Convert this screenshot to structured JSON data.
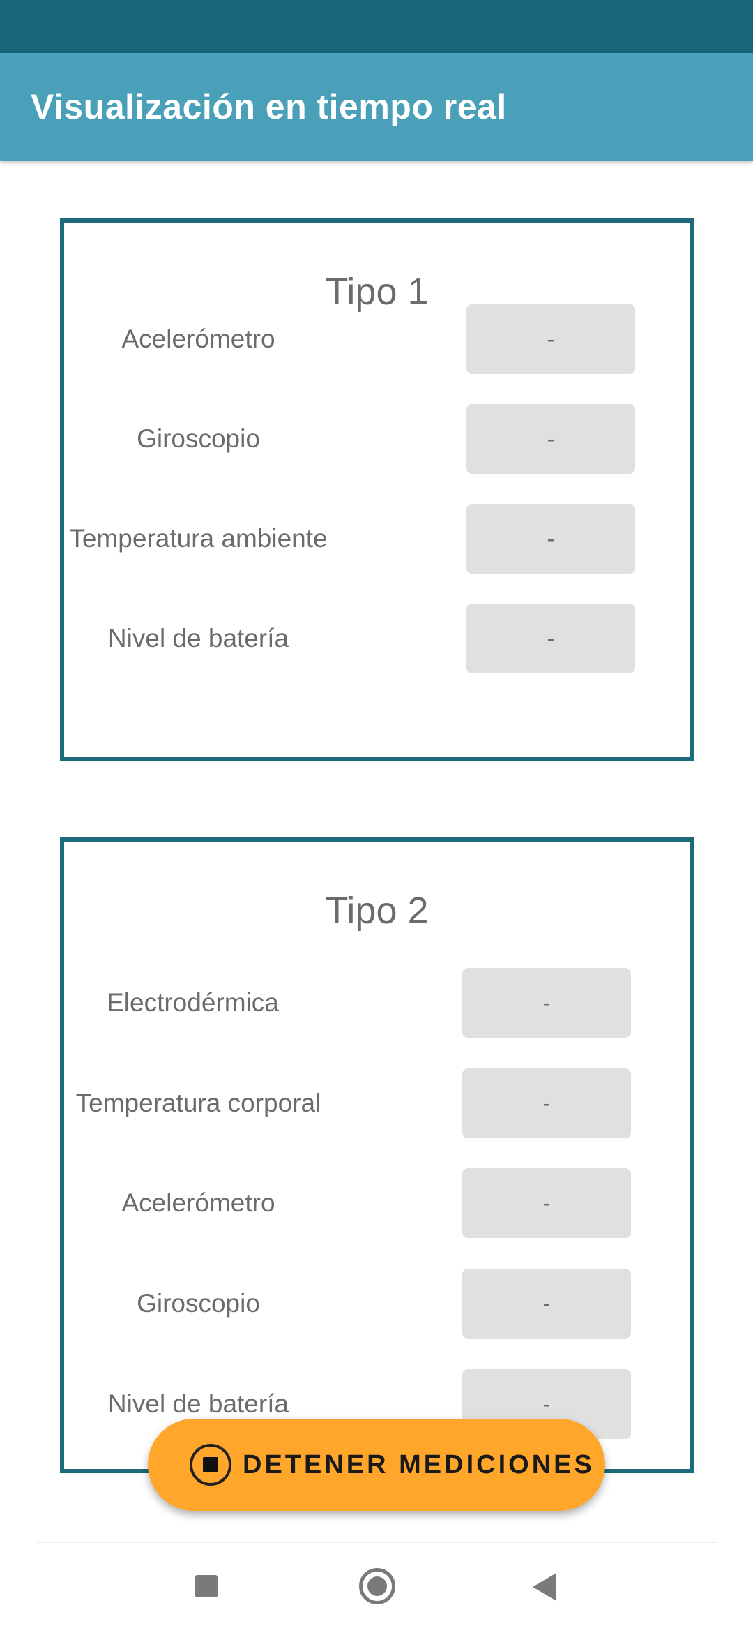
{
  "app_bar": {
    "title": "Visualización en tiempo real"
  },
  "cards": [
    {
      "title": "Tipo 1",
      "rows": [
        {
          "label": "Acelerómetro",
          "value": "-"
        },
        {
          "label": "Giroscopio",
          "value": "-"
        },
        {
          "label": "Temperatura ambiente",
          "value": "-"
        },
        {
          "label": "Nivel de batería",
          "value": "-"
        }
      ]
    },
    {
      "title": "Tipo 2",
      "rows": [
        {
          "label": "Electrodérmica",
          "value": "-"
        },
        {
          "label": "Temperatura corporal",
          "value": "-"
        },
        {
          "label": "Acelerómetro",
          "value": "-"
        },
        {
          "label": "Giroscopio",
          "value": "-"
        },
        {
          "label": "Nivel de batería",
          "value": "-"
        }
      ]
    }
  ],
  "fab": {
    "label": "DETENER MEDICIONES",
    "icon": "stop-circle-icon"
  },
  "nav": {
    "icons": [
      "recents-icon",
      "home-icon",
      "back-icon"
    ]
  },
  "colors": {
    "status_bar": "#176579",
    "app_bar": "#4aa0b8",
    "card_border": "#1c6a7c",
    "fab": "#ffa62b",
    "value_box": "#e0e0e0"
  }
}
